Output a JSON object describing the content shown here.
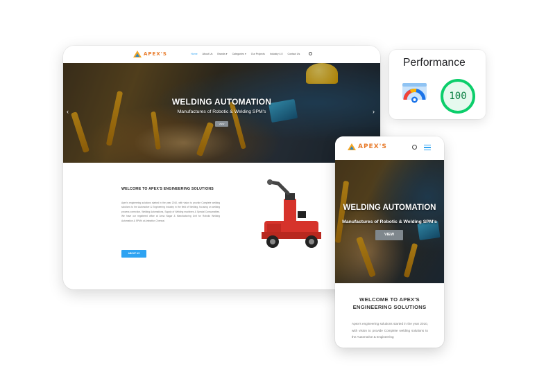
{
  "brand": {
    "logo_text": "APEX'S"
  },
  "desktop": {
    "nav": {
      "items": [
        {
          "label": "Home",
          "active": true
        },
        {
          "label": "About Us",
          "active": false
        },
        {
          "label": "Brands ▾",
          "active": false
        },
        {
          "label": "Categories ▾",
          "active": false
        },
        {
          "label": "Our Projects",
          "active": false
        },
        {
          "label": "Industry 4.0",
          "active": false
        },
        {
          "label": "Contact Us",
          "active": false
        }
      ]
    },
    "hero": {
      "title": "WELDING AUTOMATION",
      "subtitle": "Manufactures of Robotic & Welding SPM's",
      "button": "VIEW",
      "prev_icon": "‹",
      "next_icon": "›"
    },
    "content": {
      "heading": "WELCOME TO APEX'S ENGINEERING SOLUTIONS",
      "paragraph": "Apex's engineering solutions started in the year 2010, with vision to provide Complete welding solutions to the Automotive & Engineering Industry in the field of Welding, focusing on welding process correction, Welding Automations, Supply of Welding machines & Special Consumables. We have our registered office at Anna Nagar & Manufacturing Unit for Robotic Welding Automation & SPM's at Ambattur, Chennai.",
      "button": "ABOUT US"
    }
  },
  "performance": {
    "title": "Performance",
    "score": "100",
    "colors": {
      "pass": "#0cce6b",
      "pass_bg": "#e6f9ee"
    }
  },
  "mobile": {
    "hero": {
      "title": "WELDING AUTOMATION",
      "subtitle": "Manufactures of Robotic & Welding SPM's",
      "button": "VIEW"
    },
    "content": {
      "heading_line1": "WELCOME TO APEX'S",
      "heading_line2": "ENGINEERING SOLUTIONS",
      "paragraph": "Apex's engineering solutions started in the year 2010, with vision to provide Complete welding solutions to the Automotive & Engineering"
    }
  },
  "colors": {
    "accent": "#2ea3f2",
    "logo": "#e87b2b"
  }
}
